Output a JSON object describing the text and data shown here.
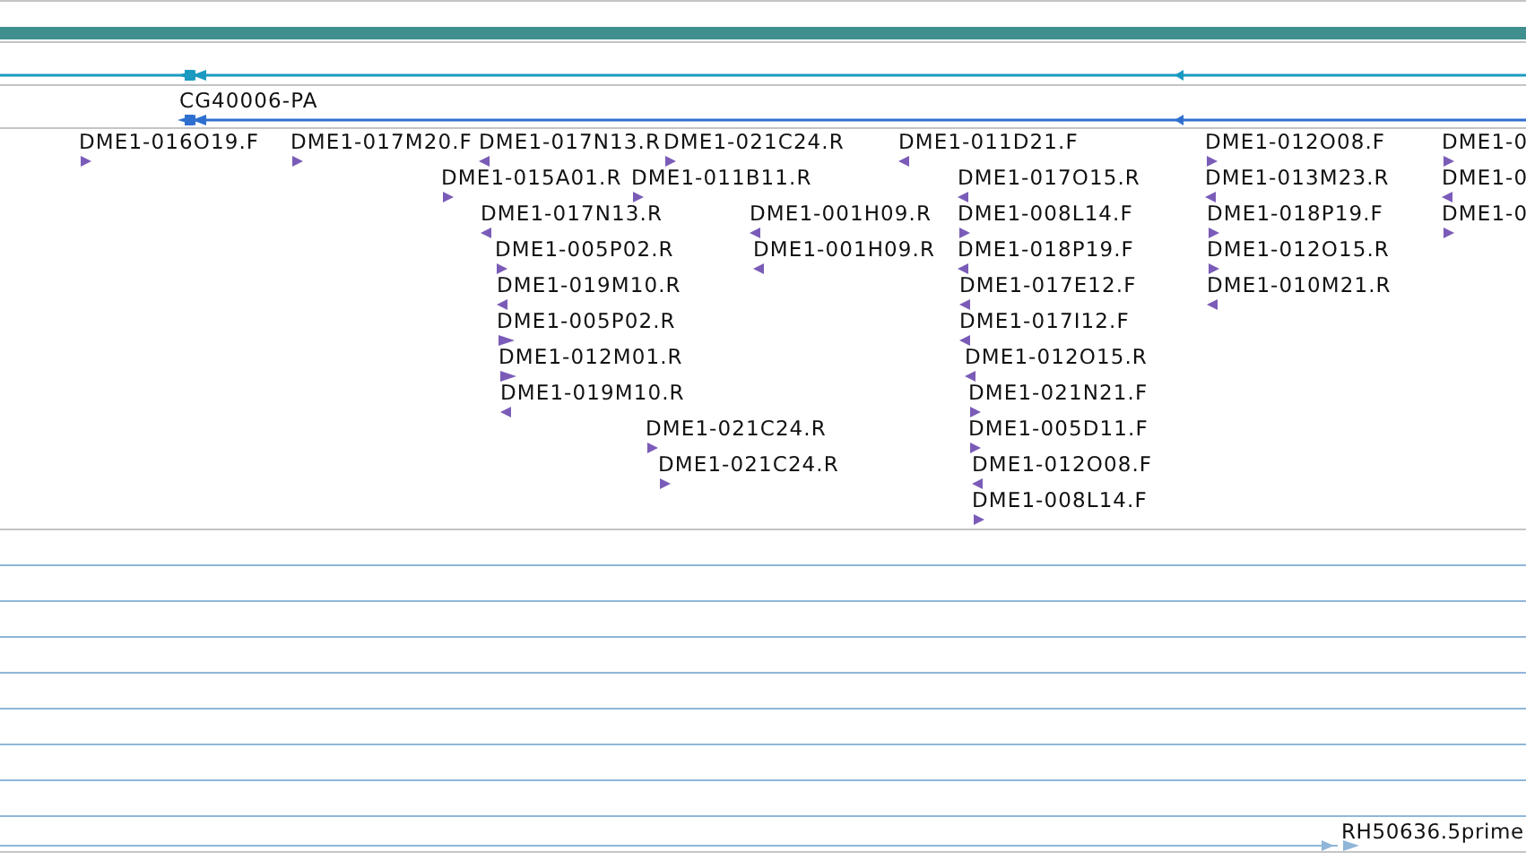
{
  "transcript_track": {
    "reverse_strand": true
  },
  "gene_model": {
    "label": "CG40006-PA",
    "reverse_strand": true
  },
  "clone_ends": [
    {
      "label": "DME1-016O19.F",
      "reverse_strand": false
    },
    {
      "label": "DME1-017M20.F",
      "reverse_strand": false
    },
    {
      "label": "DME1-017N13.R",
      "reverse_strand": true
    },
    {
      "label": "DME1-021C24.R",
      "reverse_strand": false
    },
    {
      "label": "DME1-011D21.F",
      "reverse_strand": true
    },
    {
      "label": "DME1-012O08.F",
      "reverse_strand": false
    },
    {
      "label": "DME1-0",
      "reverse_strand": false
    },
    {
      "label": "DME1-015A01.R",
      "reverse_strand": false
    },
    {
      "label": "DME1-011B11.R",
      "reverse_strand": false
    },
    {
      "label": "DME1-017O15.R",
      "reverse_strand": true
    },
    {
      "label": "DME1-013M23.R",
      "reverse_strand": true
    },
    {
      "label": "DME1-0",
      "reverse_strand": true
    },
    {
      "label": "DME1-017N13.R",
      "reverse_strand": true
    },
    {
      "label": "DME1-001H09.R",
      "reverse_strand": true
    },
    {
      "label": "DME1-008L14.F",
      "reverse_strand": false
    },
    {
      "label": "DME1-018P19.F",
      "reverse_strand": false
    },
    {
      "label": "DME1-0",
      "reverse_strand": false
    },
    {
      "label": "DME1-005P02.R",
      "reverse_strand": false
    },
    {
      "label": "DME1-001H09.R",
      "reverse_strand": true
    },
    {
      "label": "DME1-018P19.F",
      "reverse_strand": true
    },
    {
      "label": "DME1-012O15.R",
      "reverse_strand": false
    },
    {
      "label": "DME1-019M10.R",
      "reverse_strand": true
    },
    {
      "label": "DME1-017E12.F",
      "reverse_strand": true
    },
    {
      "label": "DME1-010M21.R",
      "reverse_strand": true
    },
    {
      "label": "DME1-005P02.R",
      "reverse_strand": false
    },
    {
      "label": "DME1-017I12.F",
      "reverse_strand": true
    },
    {
      "label": "DME1-012M01.R",
      "reverse_strand": false
    },
    {
      "label": "DME1-012O15.R",
      "reverse_strand": true
    },
    {
      "label": "DME1-019M10.R",
      "reverse_strand": true
    },
    {
      "label": "DME1-021N21.F",
      "reverse_strand": false
    },
    {
      "label": "DME1-021C24.R",
      "reverse_strand": false
    },
    {
      "label": "DME1-005D11.F",
      "reverse_strand": false
    },
    {
      "label": "DME1-021C24.R",
      "reverse_strand": false
    },
    {
      "label": "DME1-012O08.F",
      "reverse_strand": true
    },
    {
      "label": "DME1-008L14.F",
      "reverse_strand": false
    }
  ],
  "est_track": {
    "label": "RH50636.5prime",
    "reverse_strand": false
  }
}
